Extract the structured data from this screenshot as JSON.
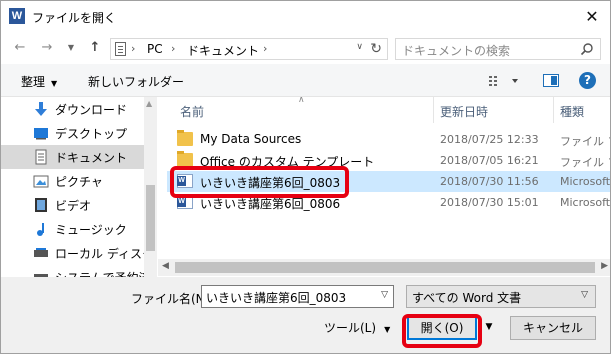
{
  "window": {
    "title": "ファイルを開く",
    "app_icon_letter": "W",
    "close_glyph": "✕"
  },
  "address": {
    "crumbs": [
      "PC",
      "ドキュメント"
    ],
    "separators": [
      "›",
      "›",
      "›"
    ],
    "search_placeholder": "ドキュメントの検索"
  },
  "toolbar": {
    "organize_label": "整理",
    "new_folder_label": "新しいフォルダー",
    "help_glyph": "?"
  },
  "sidebar": {
    "items": [
      {
        "label": "ダウンロード",
        "icon": "download-icon"
      },
      {
        "label": "デスクトップ",
        "icon": "desktop-icon"
      },
      {
        "label": "ドキュメント",
        "icon": "documents-icon",
        "selected": true
      },
      {
        "label": "ピクチャ",
        "icon": "pictures-icon"
      },
      {
        "label": "ビデオ",
        "icon": "videos-icon"
      },
      {
        "label": "ミュージック",
        "icon": "music-icon"
      },
      {
        "label": "ローカル ディスク (C",
        "icon": "disk-icon"
      },
      {
        "label": "システムで予約済",
        "icon": "disk-icon"
      }
    ]
  },
  "filelist": {
    "columns": {
      "name": "名前",
      "date": "更新日時",
      "type": "種類"
    },
    "rows": [
      {
        "name": "My Data Sources",
        "date": "2018/07/25 12:33",
        "type": "ファイル フォ",
        "kind": "folder"
      },
      {
        "name": "Office のカスタム テンプレート",
        "date": "2018/07/05 16:21",
        "type": "ファイル フォ",
        "kind": "folder"
      },
      {
        "name": "いきいき講座第6回_0803",
        "date": "2018/07/30 11:56",
        "type": "Microsoft",
        "kind": "word",
        "selected": true
      },
      {
        "name": "いきいき講座第6回_0806",
        "date": "2018/07/30 15:01",
        "type": "Microsoft",
        "kind": "word"
      }
    ]
  },
  "footer": {
    "filename_label": "ファイル名(N):",
    "filename_value": "いきいき講座第6回_0803",
    "filetype_value": "すべての Word 文書",
    "tools_label": "ツール(L)",
    "open_label": "開く(O)",
    "cancel_label": "キャンセル"
  },
  "colors": {
    "accent": "#0078d7",
    "selection": "#cce8ff",
    "highlight": "#e60012",
    "word_blue": "#2b579a",
    "folder": "#f1c24b"
  }
}
